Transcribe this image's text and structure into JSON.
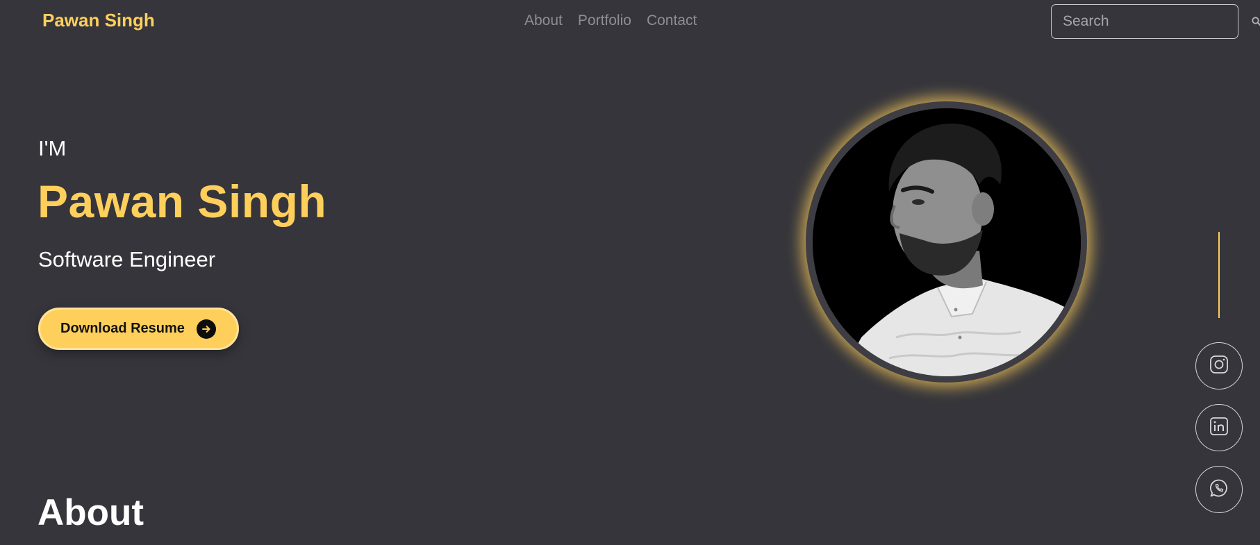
{
  "header": {
    "brand": "Pawan Singh",
    "nav": [
      {
        "label": "About"
      },
      {
        "label": "Portfolio"
      },
      {
        "label": "Contact"
      }
    ],
    "search": {
      "placeholder": "Search",
      "value": "",
      "icon": "search-icon"
    }
  },
  "hero": {
    "intro": "I'M",
    "name": "Pawan Singh",
    "role": "Software Engineer",
    "resume_button": {
      "label": "Download Resume",
      "icon": "arrow-right-circle-icon"
    },
    "portrait": {
      "icon": "profile-photo"
    }
  },
  "socials": [
    {
      "name": "instagram",
      "icon": "instagram-icon"
    },
    {
      "name": "linkedin",
      "icon": "linkedin-icon"
    },
    {
      "name": "whatsapp",
      "icon": "whatsapp-icon"
    }
  ],
  "about": {
    "heading": "About"
  },
  "colors": {
    "background": "#35353b",
    "accent": "#ffcf5c",
    "nav_text": "#8e8e94",
    "text": "#ffffff"
  }
}
